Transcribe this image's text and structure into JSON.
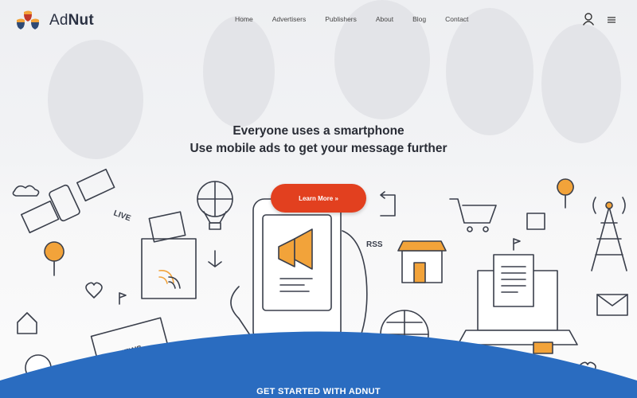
{
  "brand": {
    "name_prefix": "Ad",
    "name_suffix": "Nut",
    "icon": "acorn-cluster-logo-icon"
  },
  "nav": {
    "items": [
      {
        "label": "Home"
      },
      {
        "label": "Advertisers"
      },
      {
        "label": "Publishers"
      },
      {
        "label": "About"
      },
      {
        "label": "Blog"
      },
      {
        "label": "Contact"
      }
    ],
    "user_icon": "user-icon",
    "menu_icon": "hamburger-menu-icon"
  },
  "hero": {
    "line1": "Everyone uses a smartphone",
    "line2": "Use mobile ads to get your message further",
    "cta_label": "Learn More »"
  },
  "doodle_labels": {
    "live": "LIVE",
    "rss": "RSS",
    "news": "NEWS"
  },
  "section": {
    "get_started": "GET STARTED WITH ADNUT"
  },
  "colors": {
    "accent": "#e2401f",
    "brand_blue": "#2a6cc0",
    "doodle_orange": "#f2a33a",
    "ink": "#3a3f4b"
  }
}
